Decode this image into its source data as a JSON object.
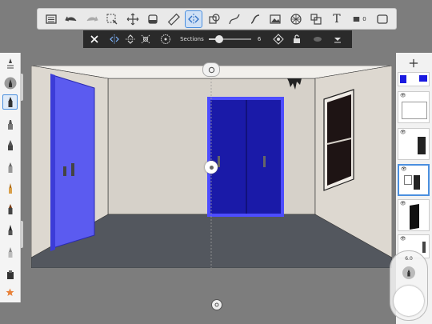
{
  "toolbar": {
    "tools": [
      {
        "name": "list-icon"
      },
      {
        "name": "undo-icon"
      },
      {
        "name": "redo-icon"
      },
      {
        "name": "select-icon"
      },
      {
        "name": "transform-icon"
      },
      {
        "name": "fill-icon"
      },
      {
        "name": "ruler-icon"
      },
      {
        "name": "symmetry-icon",
        "active": true
      },
      {
        "name": "shapes-icon"
      },
      {
        "name": "curve-icon"
      },
      {
        "name": "stroke-icon"
      },
      {
        "name": "image-icon"
      },
      {
        "name": "perspective-icon"
      },
      {
        "name": "stamp-icon"
      },
      {
        "name": "text-icon",
        "label": "T"
      },
      {
        "name": "flipbook-icon",
        "label": "0"
      },
      {
        "name": "fullscreen-icon"
      }
    ]
  },
  "symmetry_bar": {
    "sections_label": "Sections",
    "sections_value": "6",
    "slider_fraction": 0.25
  },
  "puck": {
    "size_label": "6.0"
  },
  "colors": {
    "accent": "#4a8fdf",
    "door_blue": "#1a1aa8",
    "door_light_blue": "#5b5bf0",
    "floor": "#53575e",
    "wall": "#d9d4cc"
  }
}
